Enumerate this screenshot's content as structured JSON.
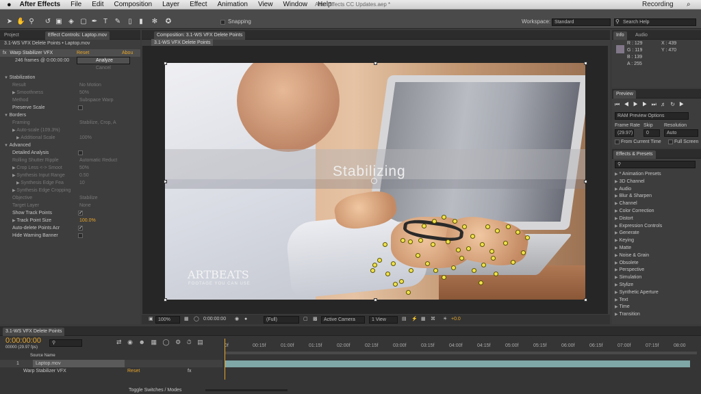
{
  "menubar": {
    "apple": "",
    "app": "After Effects",
    "items": [
      "File",
      "Edit",
      "Composition",
      "Layer",
      "Effect",
      "Animation",
      "View",
      "Window",
      "Help"
    ],
    "window_title": "After Effects CC Updates.aep *",
    "recording": "Recording"
  },
  "toolbar": {
    "snapping": "Snapping",
    "workspace_label": "Workspace:",
    "workspace_value": "Standard",
    "search_help": "Search Help"
  },
  "left_panel": {
    "tabs": [
      "Project",
      "Effect Controls: Laptop.mov"
    ],
    "header": "3.1-WS VFX Delete Points • Laptop.mov",
    "effect_name": "Warp Stabilizer VFX",
    "reset": "Reset",
    "about": "Abou",
    "frames_text": "246 frames @ 0:00:00:00",
    "analyze": "Analyze",
    "cancel": "Cancel",
    "rows": [
      {
        "label": "Stabilization",
        "value": "",
        "indent": 0,
        "dim": false,
        "twirl": "▼"
      },
      {
        "label": "Result",
        "value": "No Motion",
        "indent": 2,
        "dim": true,
        "twirl": ""
      },
      {
        "label": "Smoothness",
        "value": "50%",
        "indent": 2,
        "dim": true,
        "twirl": "▶"
      },
      {
        "label": "Method",
        "value": "Subspace Warp",
        "indent": 2,
        "dim": true,
        "twirl": ""
      },
      {
        "label": "Preserve Scale",
        "value": "",
        "indent": 2,
        "dim": false,
        "twirl": "",
        "check": false
      },
      {
        "label": "Borders",
        "value": "",
        "indent": 0,
        "dim": false,
        "twirl": "▼"
      },
      {
        "label": "Framing",
        "value": "Stabilize, Crop, A",
        "indent": 2,
        "dim": true,
        "twirl": ""
      },
      {
        "label": "Auto-scale (109.3%)",
        "value": "",
        "indent": 2,
        "dim": true,
        "twirl": "▶"
      },
      {
        "label": "Additional Scale",
        "value": "100%",
        "indent": 3,
        "dim": true,
        "twirl": "▶"
      },
      {
        "label": "Advanced",
        "value": "",
        "indent": 0,
        "dim": false,
        "twirl": "▼"
      },
      {
        "label": "Detailed Analysis",
        "value": "",
        "indent": 2,
        "dim": false,
        "twirl": "",
        "check": false
      },
      {
        "label": "Rolling Shutter Ripple",
        "value": "Automatic Reduct",
        "indent": 2,
        "dim": true,
        "twirl": ""
      },
      {
        "label": "Crop Less <-> Smoot",
        "value": "50%",
        "indent": 2,
        "dim": true,
        "twirl": "▶"
      },
      {
        "label": "Synthesis Input Range",
        "value": "0.50",
        "indent": 2,
        "dim": true,
        "twirl": "▶"
      },
      {
        "label": "Synthesis Edge Fea",
        "value": "10",
        "indent": 3,
        "dim": true,
        "twirl": "▶"
      },
      {
        "label": "Synthesis Edge Cropping",
        "value": "",
        "indent": 2,
        "dim": true,
        "twirl": "▶"
      },
      {
        "label": "Objective",
        "value": "Stabilize",
        "indent": 2,
        "dim": true,
        "twirl": ""
      },
      {
        "label": "Target Layer",
        "value": "None",
        "indent": 2,
        "dim": true,
        "twirl": ""
      },
      {
        "label": "Show Track Points",
        "value": "",
        "indent": 2,
        "dim": false,
        "twirl": "",
        "check": true
      },
      {
        "label": "Track Point Size",
        "value": "100.0%",
        "indent": 2,
        "dim": false,
        "twirl": "▶",
        "orange": true
      },
      {
        "label": "Auto-delete Points Acr",
        "value": "",
        "indent": 2,
        "dim": false,
        "twirl": "",
        "check": true
      },
      {
        "label": "Hide Warning Banner",
        "value": "",
        "indent": 2,
        "dim": false,
        "twirl": "",
        "check": false
      }
    ]
  },
  "composition": {
    "tab": "Composition: 3.1-WS VFX Delete Points",
    "breadcrumb": "3.1-WS VFX Delete Points",
    "overlay_text": "Stabilizing",
    "watermark": "ARTBEATS",
    "watermark_sub": "FOOTAGE YOU CAN USE",
    "footer": {
      "zoom": "100%",
      "timecode": "0:00:00:00",
      "resolution": "(Full)",
      "camera": "Active Camera",
      "views": "1 View",
      "exposure": "+0.0"
    }
  },
  "info": {
    "tabs": [
      "Info",
      "Audio"
    ],
    "r": "R : 129",
    "g": "G : 119",
    "b": "B : 139",
    "a": "A : 255",
    "x": "X : 439",
    "y": "Y : 470",
    "swatch": "#817789"
  },
  "preview": {
    "tab": "Preview",
    "ram": "RAM Preview Options",
    "frame_rate_label": "Frame Rate",
    "skip_label": "Skip",
    "resolution_label": "Resolution",
    "frame_rate": "(29.97)",
    "skip": "0",
    "resolution": "Auto",
    "from_current": "From Current Time",
    "full_screen": "Full Screen"
  },
  "effects": {
    "tab": "Effects & Presets",
    "items": [
      "* Animation Presets",
      "3D Channel",
      "Audio",
      "Blur & Sharpen",
      "Channel",
      "Color Correction",
      "Distort",
      "Expression Controls",
      "Generate",
      "Keying",
      "Matte",
      "Noise & Grain",
      "Obsolete",
      "Perspective",
      "Simulation",
      "Stylize",
      "Synthetic Aperture",
      "Text",
      "Time",
      "Transition"
    ]
  },
  "timeline": {
    "tab": "3.1-WS VFX Delete Points",
    "timecode": "0:00:00:00",
    "fps": "00000 (29.97 fps)",
    "source_name": "Source Name",
    "layer_num": "1",
    "layer_name": "Laptop.mov",
    "effect": "Warp Stabilizer VFX",
    "reset": "Reset",
    "fx": "fx",
    "toggle": "Toggle Switches / Modes",
    "ruler": [
      "0f",
      "00:15f",
      "01:00f",
      "01:15f",
      "02:00f",
      "02:15f",
      "03:00f",
      "03:15f",
      "04:00f",
      "04:15f",
      "05:00f",
      "05:15f",
      "06:00f",
      "06:15f",
      "07:00f",
      "07:15f",
      "08:00"
    ]
  },
  "colors": {
    "accent": "#e9a72a",
    "lane": "#7fa7a7"
  }
}
